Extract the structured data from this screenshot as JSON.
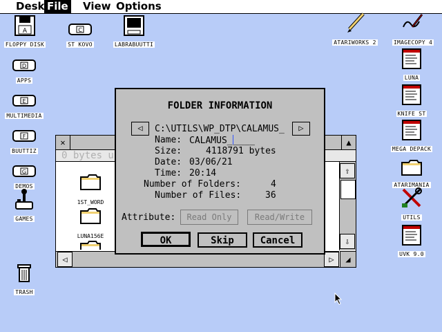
{
  "menu": {
    "desk": "Desk",
    "file": "File",
    "view": "View",
    "options": "Options"
  },
  "desktop_icons": {
    "floppy": "FLOPPY DISK",
    "st_kovo": "ST KOVO",
    "labrabuutti": "LABRABUUTTI",
    "apps": "APPS",
    "multimedia": "MULTIMEDIA",
    "buuttiz": "BUUTTIZ",
    "demos": "DEMOS",
    "games": "GAMES",
    "trash": "TRASH",
    "atariworks": "ATARIWORKS 2",
    "imagecopy": "IMAGECOPY 4",
    "luna": "LUNA",
    "knife": "KNIFE ST",
    "mega_depack": "MEGA DEPACK",
    "atarimania": "ATARIMANIA",
    "utils": "UTILS",
    "uvk": "UVK 9.0"
  },
  "drive_letters": {
    "floppy": "A",
    "st_kovo": "C",
    "apps": "D",
    "multimedia": "E",
    "buuttiz": "F",
    "demos": "G"
  },
  "background_window": {
    "info_text": "0 bytes us",
    "folders": [
      "1ST_WORD",
      "LUNA156E",
      ""
    ]
  },
  "dialog": {
    "title": "FOLDER INFORMATION",
    "path": "C:\\UTILS\\WP_DTP\\CALAMUS_",
    "name_label": "Name:",
    "name_value": "CALAMUS_",
    "name_blank": "____",
    "size_label": "Size:",
    "size_value": "4118791 bytes",
    "date_label": "Date:",
    "date_value": "03/06/21",
    "time_label": "Time:",
    "time_value": "20:14",
    "folders_label": "Number of Folders:",
    "folders_value": "4",
    "files_label": "Number of Files:",
    "files_value": "36",
    "attribute_label": "Attribute:",
    "read_only": "Read Only",
    "read_write": "Read/Write",
    "ok": "OK",
    "skip": "Skip",
    "cancel": "Cancel"
  },
  "icons": {
    "left_arrow": "left-arrow-icon",
    "right_arrow": "right-arrow-icon",
    "close": "close-icon",
    "up_arrow": "up-arrow-icon",
    "down_arrow": "down-arrow-icon",
    "resize": "resize-icon"
  },
  "colors": {
    "desktop": "#b8ccf8",
    "dialog": "#c0c0c0"
  }
}
